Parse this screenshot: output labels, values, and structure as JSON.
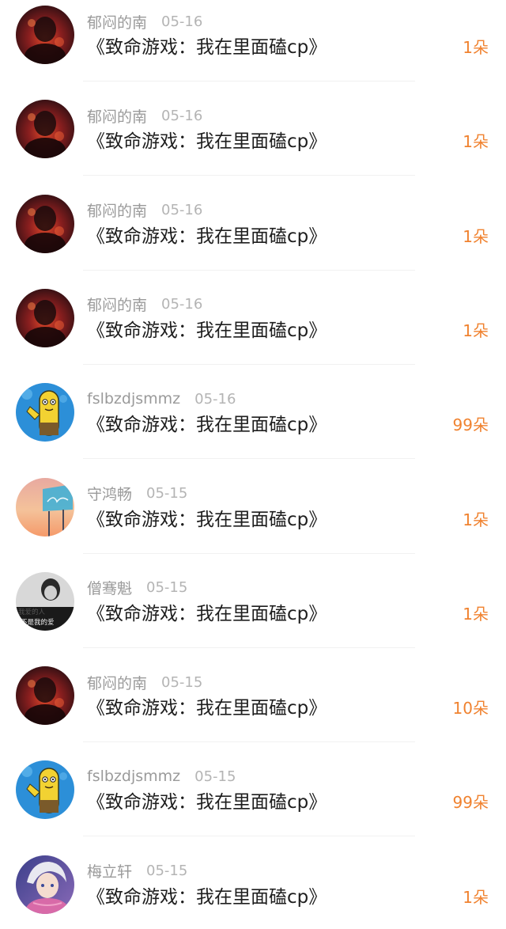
{
  "colors": {
    "gift_text": "#f0822f",
    "username_text": "#9a9a9a",
    "date_text": "#b4b4b4",
    "title_text": "#1e1e1e"
  },
  "items": [
    {
      "username": "郁闷的南",
      "date": "05-16",
      "title": "《致命游戏：我在里面磕cp》",
      "gift": "1朵",
      "avatar_icon": "dark-red-figure-avatar"
    },
    {
      "username": "郁闷的南",
      "date": "05-16",
      "title": "《致命游戏：我在里面磕cp》",
      "gift": "1朵",
      "avatar_icon": "dark-red-figure-avatar"
    },
    {
      "username": "郁闷的南",
      "date": "05-16",
      "title": "《致命游戏：我在里面磕cp》",
      "gift": "1朵",
      "avatar_icon": "dark-red-figure-avatar"
    },
    {
      "username": "郁闷的南",
      "date": "05-16",
      "title": "《致命游戏：我在里面磕cp》",
      "gift": "1朵",
      "avatar_icon": "dark-red-figure-avatar"
    },
    {
      "username": "fslbzdjsmmz",
      "date": "05-16",
      "title": "《致命游戏：我在里面磕cp》",
      "gift": "99朵",
      "avatar_icon": "yellow-cartoon-fish-avatar"
    },
    {
      "username": "守鸿畅",
      "date": "05-15",
      "title": "《致命游戏：我在里面磕cp》",
      "gift": "1朵",
      "avatar_icon": "sunset-billboard-avatar"
    },
    {
      "username": "僧骞魁",
      "date": "05-15",
      "title": "《致命游戏：我在里面磕cp》",
      "gift": "1朵",
      "avatar_icon": "bw-portrait-text-avatar",
      "avatar_text": [
        "我爱的人",
        "不是我的爱"
      ]
    },
    {
      "username": "郁闷的南",
      "date": "05-15",
      "title": "《致命游戏：我在里面磕cp》",
      "gift": "10朵",
      "avatar_icon": "dark-red-figure-avatar"
    },
    {
      "username": "fslbzdjsmmz",
      "date": "05-15",
      "title": "《致命游戏：我在里面磕cp》",
      "gift": "99朵",
      "avatar_icon": "yellow-cartoon-fish-avatar"
    },
    {
      "username": "梅立轩",
      "date": "05-15",
      "title": "《致命游戏：我在里面磕cp》",
      "gift": "1朵",
      "avatar_icon": "anime-character-avatar"
    }
  ]
}
